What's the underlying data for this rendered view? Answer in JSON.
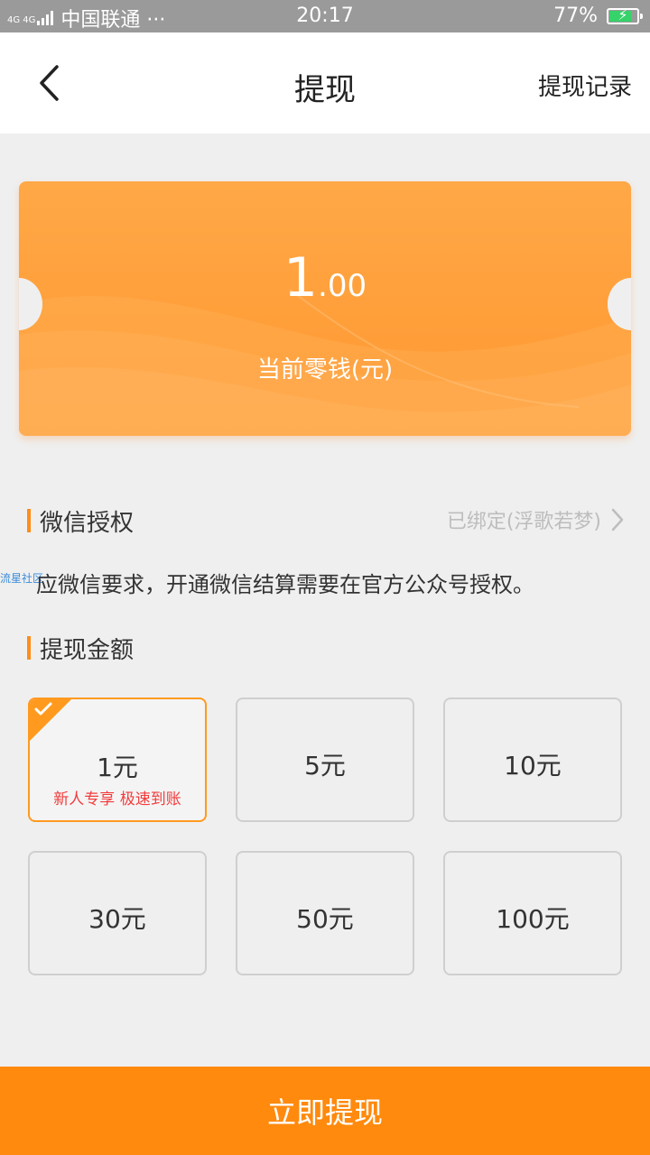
{
  "status_bar": {
    "network": "4G 4G",
    "carrier": "中国联通 ···",
    "time": "20:17",
    "battery": "77%"
  },
  "nav": {
    "title": "提现",
    "record_label": "提现记录"
  },
  "balance": {
    "integer": "1",
    "decimal": ".00",
    "label": "当前零钱(元)"
  },
  "wechat_auth": {
    "title": "微信授权",
    "status": "已绑定(浮歌若梦)",
    "description": "应微信要求，开通微信结算需要在官方公众号授权。",
    "watermark": "流星社区"
  },
  "withdraw_amount": {
    "title": "提现金额",
    "options": [
      {
        "label": "1元",
        "promo": "新人专享  极速到账",
        "selected": true
      },
      {
        "label": "5元"
      },
      {
        "label": "10元"
      },
      {
        "label": "30元"
      },
      {
        "label": "50元"
      },
      {
        "label": "100元"
      }
    ]
  },
  "submit_label": "立即提现",
  "colors": {
    "accent": "#ff8a0d",
    "selected_border": "#ff9a1f",
    "promo_text": "#f23c3c",
    "card_gradient_top": "#ffa847",
    "card_gradient_bottom": "#ff9a34"
  }
}
